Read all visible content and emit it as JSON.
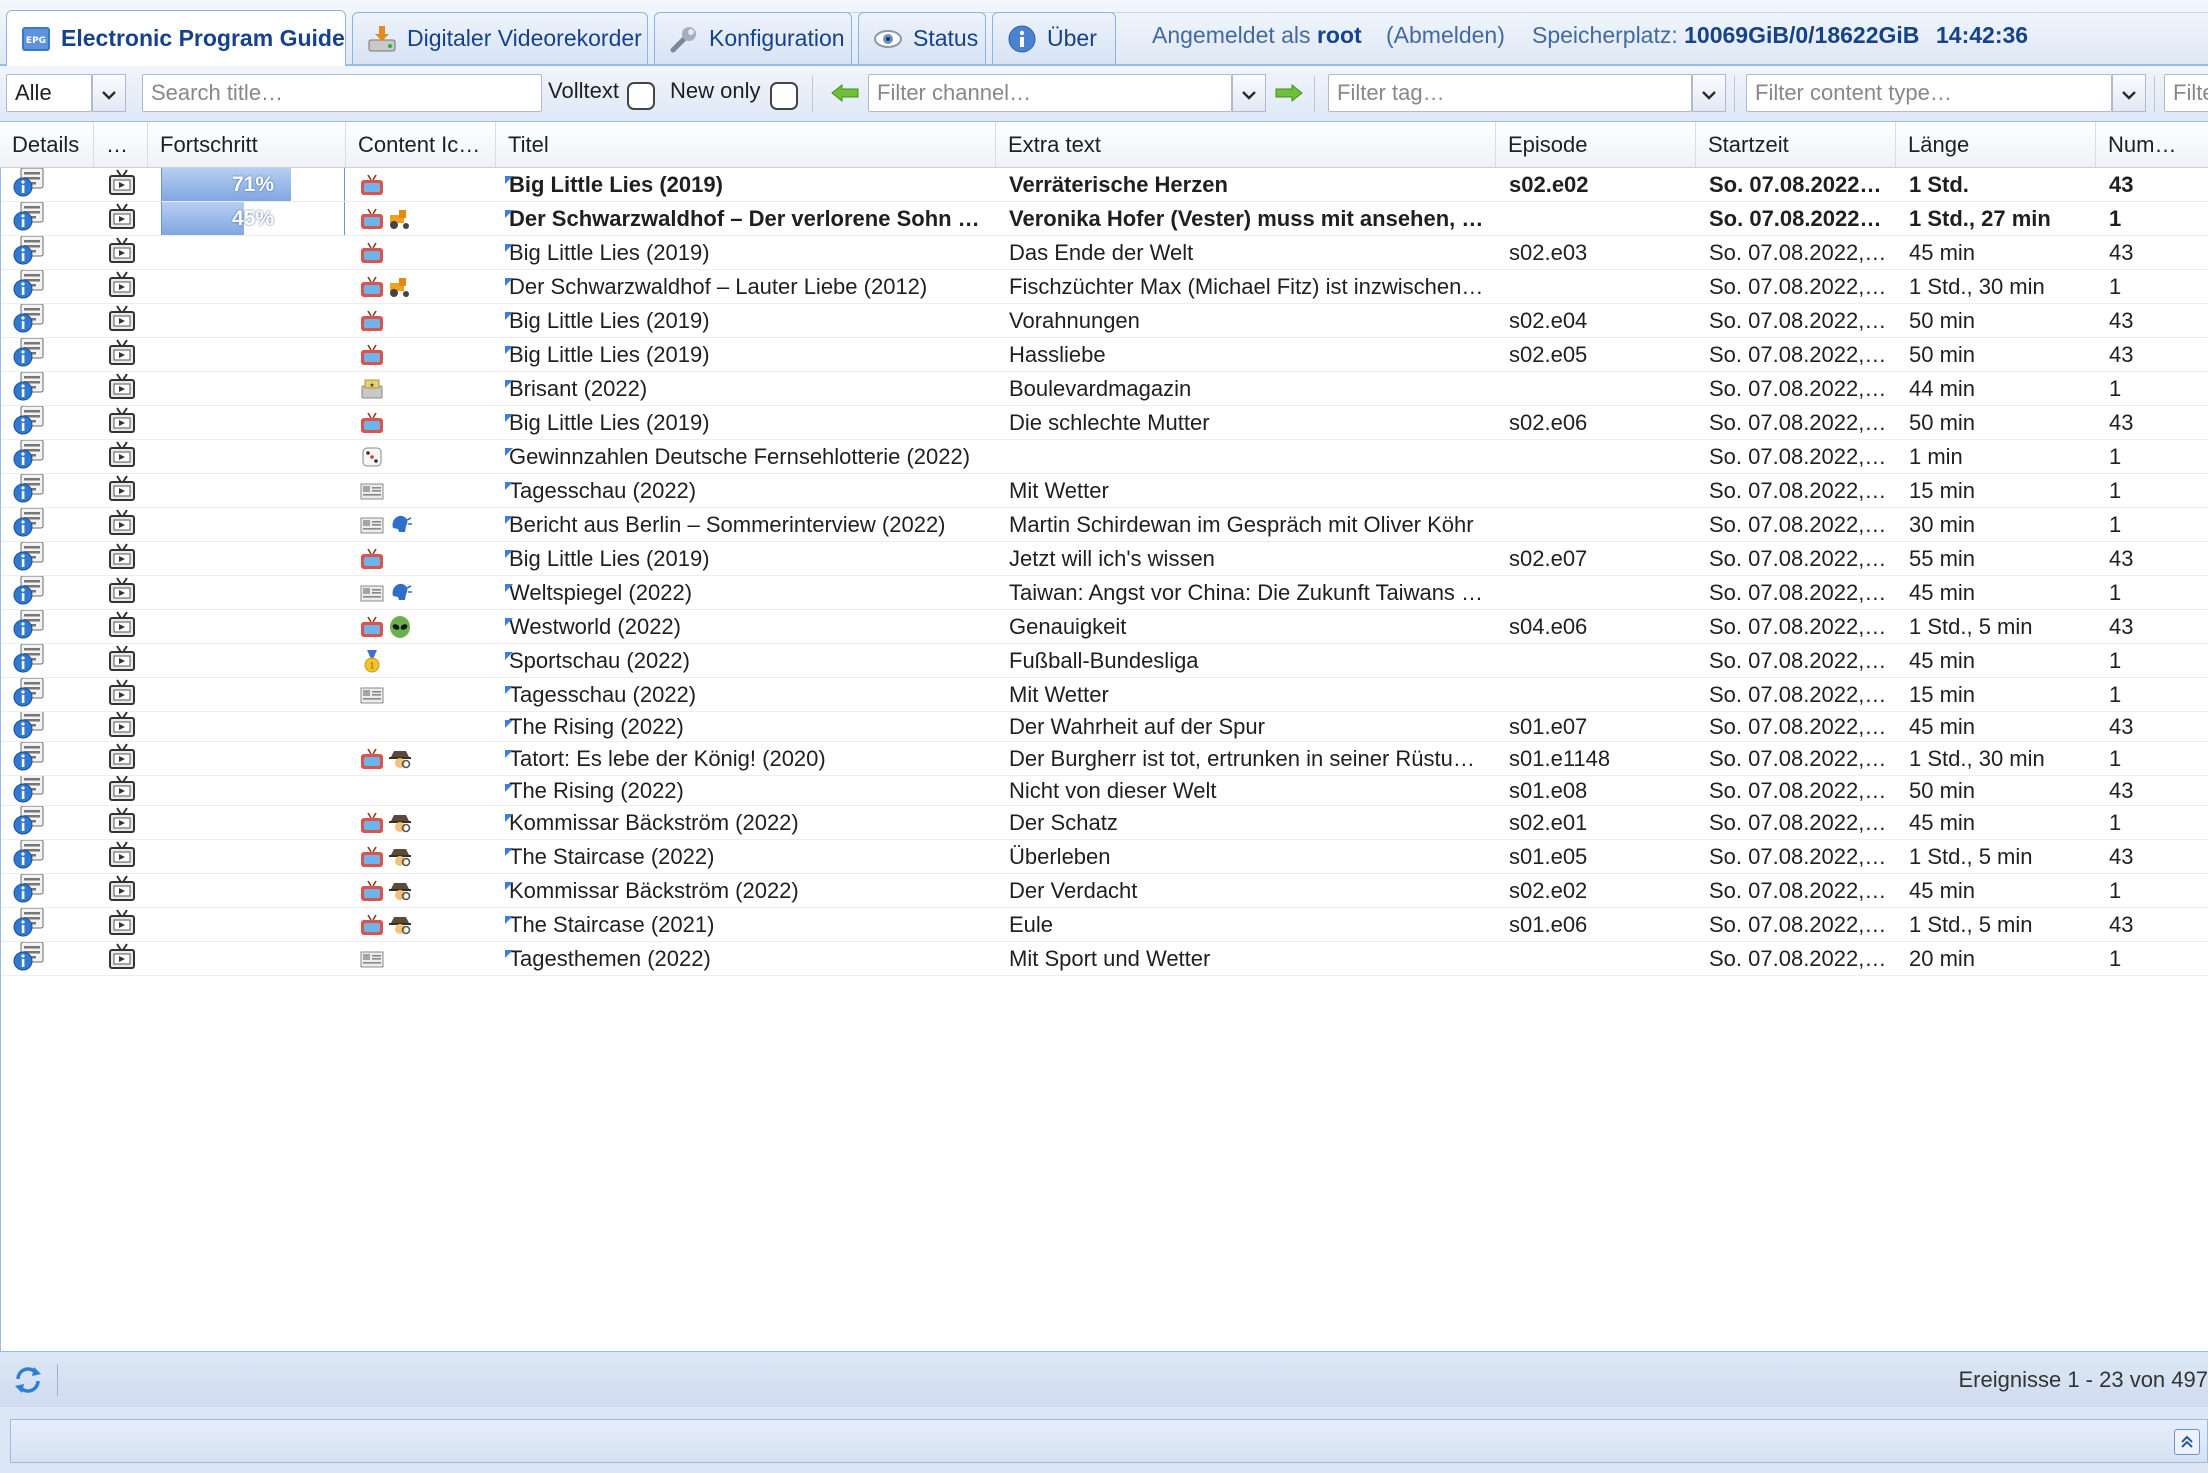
{
  "tabs": [
    {
      "label": "Electronic Program Guide",
      "icon": "epg-icon",
      "active": true
    },
    {
      "label": "Digitaler Videorekorder",
      "icon": "dvr-icon",
      "active": false
    },
    {
      "label": "Konfiguration",
      "icon": "wrench-icon",
      "active": false
    },
    {
      "label": "Status",
      "icon": "eye-icon",
      "active": false
    },
    {
      "label": "Über",
      "icon": "info-icon",
      "active": false
    }
  ],
  "header": {
    "logged_in_prefix": "Angemeldet als",
    "user": "root",
    "logout": "(Abmelden)",
    "storage_label": "Speicherplatz:",
    "storage_value": "10069GiB/0/18622GiB",
    "time": "14:42:36"
  },
  "toolbar": {
    "filter_select_value": "Alle",
    "search_placeholder": "Search title…",
    "volltext_label": "Volltext",
    "new_only_label": "New only",
    "channel_placeholder": "Filter channel…",
    "tag_placeholder": "Filter tag…",
    "content_type_placeholder": "Filter content type…",
    "extra_placeholder": "Filte"
  },
  "columns": [
    "Details",
    "…",
    "Fortschritt",
    "Content Ic…",
    "Titel",
    "Extra text",
    "Episode",
    "Startzeit",
    "Länge",
    "Num…"
  ],
  "rows": [
    {
      "bold": true,
      "progress": 71,
      "progress_label": "71%",
      "icons": [
        "tv"
      ],
      "title": "Big Little Lies (2019)",
      "extra": "Verräterische Herzen",
      "episode": "s02.e02",
      "start": "So. 07.08.2022,…",
      "length": "1 Std.",
      "num": "43"
    },
    {
      "bold": true,
      "progress": 45,
      "progress_label": "45%",
      "icons": [
        "tv",
        "tractor"
      ],
      "title": "Der Schwarzwaldhof – Der verlorene Sohn …",
      "extra": "Veronika Hofer (Vester) muss mit ansehen, …",
      "episode": "",
      "start": "So. 07.08.2022,…",
      "length": "1 Std., 27 min",
      "num": "1"
    },
    {
      "bold": false,
      "progress": null,
      "progress_label": "",
      "icons": [
        "tv"
      ],
      "title": "Big Little Lies (2019)",
      "extra": "Das Ende der Welt",
      "episode": "s02.e03",
      "start": "So. 07.08.2022,…",
      "length": "45 min",
      "num": "43"
    },
    {
      "bold": false,
      "progress": null,
      "progress_label": "",
      "icons": [
        "tv",
        "tractor"
      ],
      "title": "Der Schwarzwaldhof – Lauter Liebe (2012)",
      "extra": "Fischzüchter Max (Michael Fitz) ist inzwischen…",
      "episode": "",
      "start": "So. 07.08.2022,…",
      "length": "1 Std., 30 min",
      "num": "1"
    },
    {
      "bold": false,
      "progress": null,
      "progress_label": "",
      "icons": [
        "tv"
      ],
      "title": "Big Little Lies (2019)",
      "extra": "Vorahnungen",
      "episode": "s02.e04",
      "start": "So. 07.08.2022,…",
      "length": "50 min",
      "num": "43"
    },
    {
      "bold": false,
      "progress": null,
      "progress_label": "",
      "icons": [
        "tv"
      ],
      "title": "Big Little Lies (2019)",
      "extra": "Hassliebe",
      "episode": "s02.e05",
      "start": "So. 07.08.2022,…",
      "length": "50 min",
      "num": "43"
    },
    {
      "bold": false,
      "progress": null,
      "progress_label": "",
      "icons": [
        "magazine"
      ],
      "title": "Brisant (2022)",
      "extra": "Boulevardmagazin",
      "episode": "",
      "start": "So. 07.08.2022,…",
      "length": "44 min",
      "num": "1"
    },
    {
      "bold": false,
      "progress": null,
      "progress_label": "",
      "icons": [
        "tv"
      ],
      "title": "Big Little Lies (2019)",
      "extra": "Die schlechte Mutter",
      "episode": "s02.e06",
      "start": "So. 07.08.2022,…",
      "length": "50 min",
      "num": "43"
    },
    {
      "bold": false,
      "progress": null,
      "progress_label": "",
      "icons": [
        "dice"
      ],
      "title": "Gewinnzahlen Deutsche Fernsehlotterie (2022)",
      "extra": "",
      "episode": "",
      "start": "So. 07.08.2022,…",
      "length": "1 min",
      "num": "1"
    },
    {
      "bold": false,
      "progress": null,
      "progress_label": "",
      "icons": [
        "news"
      ],
      "title": "Tagesschau (2022)",
      "extra": "Mit Wetter",
      "episode": "",
      "start": "So. 07.08.2022,…",
      "length": "15 min",
      "num": "1"
    },
    {
      "bold": false,
      "progress": null,
      "progress_label": "",
      "icons": [
        "news",
        "speaker"
      ],
      "title": "Bericht aus Berlin – Sommerinterview (2022)",
      "extra": "Martin Schirdewan im Gespräch mit Oliver Köhr",
      "episode": "",
      "start": "So. 07.08.2022,…",
      "length": "30 min",
      "num": "1"
    },
    {
      "bold": false,
      "progress": null,
      "progress_label": "",
      "icons": [
        "tv"
      ],
      "title": "Big Little Lies (2019)",
      "extra": "Jetzt will ich's wissen",
      "episode": "s02.e07",
      "start": "So. 07.08.2022,…",
      "length": "55 min",
      "num": "43"
    },
    {
      "bold": false,
      "progress": null,
      "progress_label": "",
      "icons": [
        "news",
        "speaker"
      ],
      "title": "Weltspiegel (2022)",
      "extra": "Taiwan: Angst vor China: Die Zukunft Taiwans …",
      "episode": "",
      "start": "So. 07.08.2022,…",
      "length": "45 min",
      "num": "1"
    },
    {
      "bold": false,
      "progress": null,
      "progress_label": "",
      "icons": [
        "tv",
        "alien"
      ],
      "title": "Westworld (2022)",
      "extra": "Genauigkeit",
      "episode": "s04.e06",
      "start": "So. 07.08.2022,…",
      "length": "1 Std., 5 min",
      "num": "43"
    },
    {
      "bold": false,
      "progress": null,
      "progress_label": "",
      "icons": [
        "medal"
      ],
      "title": "Sportschau (2022)",
      "extra": "Fußball-Bundesliga",
      "episode": "",
      "start": "So. 07.08.2022,…",
      "length": "45 min",
      "num": "1"
    },
    {
      "bold": false,
      "progress": null,
      "progress_label": "",
      "icons": [
        "news"
      ],
      "title": "Tagesschau (2022)",
      "extra": "Mit Wetter",
      "episode": "",
      "start": "So. 07.08.2022,…",
      "length": "15 min",
      "num": "1"
    },
    {
      "bold": false,
      "progress": null,
      "progress_label": "",
      "icons": [],
      "title": "The Rising (2022)",
      "extra": "Der Wahrheit auf der Spur",
      "episode": "s01.e07",
      "start": "So. 07.08.2022,…",
      "length": "45 min",
      "num": "43"
    },
    {
      "bold": false,
      "progress": null,
      "progress_label": "",
      "icons": [
        "tv",
        "detective"
      ],
      "title": "Tatort: Es lebe der König! (2020)",
      "extra": "Der Burgherr ist tot, ertrunken in seiner Rüstun…",
      "episode": "s01.e1148",
      "start": "So. 07.08.2022,…",
      "length": "1 Std., 30 min",
      "num": "1"
    },
    {
      "bold": false,
      "progress": null,
      "progress_label": "",
      "icons": [],
      "title": "The Rising (2022)",
      "extra": "Nicht von dieser Welt",
      "episode": "s01.e08",
      "start": "So. 07.08.2022,…",
      "length": "50 min",
      "num": "43"
    },
    {
      "bold": false,
      "progress": null,
      "progress_label": "",
      "icons": [
        "tv",
        "detective"
      ],
      "title": "Kommissar Bäckström (2022)",
      "extra": "Der Schatz",
      "episode": "s02.e01",
      "start": "So. 07.08.2022,…",
      "length": "45 min",
      "num": "1"
    },
    {
      "bold": false,
      "progress": null,
      "progress_label": "",
      "icons": [
        "tv",
        "detective"
      ],
      "title": "The Staircase (2022)",
      "extra": "Überleben",
      "episode": "s01.e05",
      "start": "So. 07.08.2022,…",
      "length": "1 Std., 5 min",
      "num": "43"
    },
    {
      "bold": false,
      "progress": null,
      "progress_label": "",
      "icons": [
        "tv",
        "detective"
      ],
      "title": "Kommissar Bäckström (2022)",
      "extra": "Der Verdacht",
      "episode": "s02.e02",
      "start": "So. 07.08.2022,…",
      "length": "45 min",
      "num": "1"
    },
    {
      "bold": false,
      "progress": null,
      "progress_label": "",
      "icons": [
        "tv",
        "detective"
      ],
      "title": "The Staircase (2021)",
      "extra": "Eule",
      "episode": "s01.e06",
      "start": "So. 07.08.2022,…",
      "length": "1 Std., 5 min",
      "num": "43"
    },
    {
      "bold": false,
      "progress": null,
      "progress_label": "",
      "icons": [
        "news"
      ],
      "title": "Tagesthemen (2022)",
      "extra": "Mit Sport und Wetter",
      "episode": "",
      "start": "So. 07.08.2022,…",
      "length": "20 min",
      "num": "1"
    }
  ],
  "statusbar": {
    "page_info": "Ereignisse 1 - 23 von 497"
  }
}
